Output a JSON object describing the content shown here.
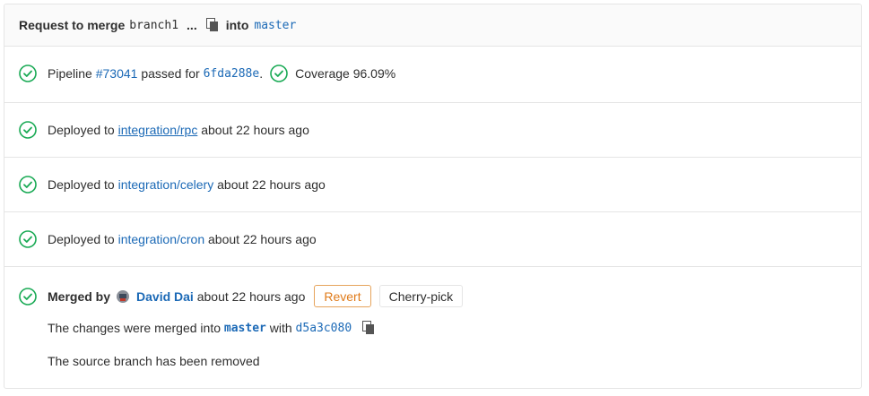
{
  "header": {
    "request_label": "Request to merge",
    "source_branch": "branch1",
    "ellipsis": "...",
    "into_label": "into",
    "target_branch": "master"
  },
  "pipeline": {
    "prefix": "Pipeline",
    "id": "#73041",
    "passed_for": "passed for",
    "sha": "6fda288e",
    "period": ".",
    "coverage": "Coverage 96.09%"
  },
  "deployments": [
    {
      "prefix": "Deployed to",
      "env": "integration/rpc",
      "time": "about 22 hours ago"
    },
    {
      "prefix": "Deployed to",
      "env": "integration/celery",
      "time": "about 22 hours ago"
    },
    {
      "prefix": "Deployed to",
      "env": "integration/cron",
      "time": "about 22 hours ago"
    }
  ],
  "merged": {
    "label": "Merged by",
    "author": "David Dai",
    "time": "about 22 hours ago",
    "revert_label": "Revert",
    "cherry_pick_label": "Cherry-pick",
    "changes_prefix": "The changes were merged into",
    "target_branch": "master",
    "with_label": "with",
    "merge_sha": "d5a3c080",
    "source_removed": "The source branch has been removed"
  },
  "colors": {
    "success": "#1aaa55",
    "link": "#1b69b6",
    "revert": "#e07b1a"
  }
}
